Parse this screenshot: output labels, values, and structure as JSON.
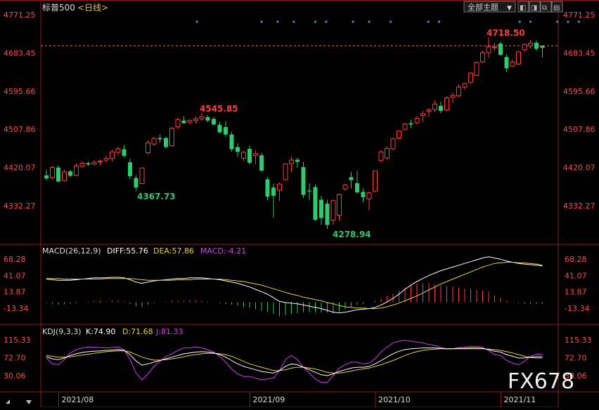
{
  "header": {
    "symbol": "标普500",
    "period": "<日线>",
    "theme_button": "全部主题",
    "theme_caret": "▼",
    "win_buttons": [
      "◧",
      "◨",
      "⧉",
      "▤"
    ]
  },
  "colors": {
    "up": "#ff3c3c",
    "down": "#32c86e",
    "axis_label": "#ff4a4a",
    "dif": "#ffffff",
    "dea": "#e6d23a",
    "macd_hist_label": "#c84bd6",
    "kdj_k": "#ffffff",
    "kdj_d": "#e6d23a",
    "kdj_j": "#d23cf0",
    "marker": "#3a8fd8",
    "frame": "#8a1a1a"
  },
  "price_panel": {
    "y_ticks": [
      "4771.25",
      "4683.45",
      "4595.66",
      "4507.86",
      "4420.07",
      "4332.27"
    ],
    "ref_line": 4700,
    "annotations": {
      "max_label": "4718.50",
      "min_label": "4278.94",
      "local_high_label": "4545.85",
      "local_low_label": "4367.73"
    },
    "markers_label": ""
  },
  "macd_panel": {
    "title": "MACD(26,12,9)",
    "dif_label": "DIFF:55.76",
    "dea_label": "DEA:57.86",
    "macd_label": "MACD:-4.21",
    "y_ticks": [
      "68.28",
      "41.07",
      "13.87",
      "-13.34"
    ]
  },
  "kdj_panel": {
    "title": "KDJ(9,3,3)",
    "k_label": "K:74.90",
    "d_label": "D:71.68",
    "j_label": "J:81.33",
    "y_ticks": [
      "115.33",
      "72.70",
      "30.06"
    ]
  },
  "x_axis": {
    "labels": [
      "2021/08",
      "2021/09",
      "2021/10",
      "2021/11"
    ]
  },
  "watermark": "FX678",
  "chart_data": {
    "type": "candlestick",
    "series_name": "标普500",
    "period": "日线",
    "ylim": [
      4250,
      4790
    ],
    "candles": [
      {
        "o": 4402,
        "h": 4415,
        "l": 4390,
        "c": 4395
      },
      {
        "o": 4397,
        "h": 4423,
        "l": 4393,
        "c": 4420
      },
      {
        "o": 4420,
        "h": 4425,
        "l": 4385,
        "c": 4388
      },
      {
        "o": 4390,
        "h": 4416,
        "l": 4388,
        "c": 4410
      },
      {
        "o": 4411,
        "h": 4415,
        "l": 4398,
        "c": 4401
      },
      {
        "o": 4402,
        "h": 4430,
        "l": 4400,
        "c": 4423
      },
      {
        "o": 4423,
        "h": 4433,
        "l": 4420,
        "c": 4430
      },
      {
        "o": 4430,
        "h": 4434,
        "l": 4424,
        "c": 4427
      },
      {
        "o": 4428,
        "h": 4437,
        "l": 4425,
        "c": 4432
      },
      {
        "o": 4433,
        "h": 4438,
        "l": 4426,
        "c": 4435
      },
      {
        "o": 4437,
        "h": 4447,
        "l": 4432,
        "c": 4441
      },
      {
        "o": 4441,
        "h": 4461,
        "l": 4434,
        "c": 4456
      },
      {
        "o": 4455,
        "h": 4468,
        "l": 4449,
        "c": 4463
      },
      {
        "o": 4462,
        "h": 4472,
        "l": 4443,
        "c": 4447
      },
      {
        "o": 4432,
        "h": 4440,
        "l": 4393,
        "c": 4400
      },
      {
        "o": 4396,
        "h": 4402,
        "l": 4367,
        "c": 4374
      },
      {
        "o": 4383,
        "h": 4420,
        "l": 4382,
        "c": 4419
      },
      {
        "o": 4454,
        "h": 4482,
        "l": 4450,
        "c": 4477
      },
      {
        "o": 4474,
        "h": 4490,
        "l": 4470,
        "c": 4487
      },
      {
        "o": 4488,
        "h": 4496,
        "l": 4477,
        "c": 4485
      },
      {
        "o": 4488,
        "h": 4490,
        "l": 4464,
        "c": 4467
      },
      {
        "o": 4470,
        "h": 4513,
        "l": 4468,
        "c": 4510
      },
      {
        "o": 4514,
        "h": 4535,
        "l": 4508,
        "c": 4530
      },
      {
        "o": 4528,
        "h": 4538,
        "l": 4520,
        "c": 4522
      },
      {
        "o": 4524,
        "h": 4532,
        "l": 4519,
        "c": 4528
      },
      {
        "o": 4528,
        "h": 4537,
        "l": 4521,
        "c": 4532
      },
      {
        "o": 4532,
        "h": 4546,
        "l": 4527,
        "c": 4537
      },
      {
        "o": 4536,
        "h": 4541,
        "l": 4524,
        "c": 4528
      },
      {
        "o": 4532,
        "h": 4536,
        "l": 4517,
        "c": 4519
      },
      {
        "o": 4518,
        "h": 4525,
        "l": 4498,
        "c": 4501
      },
      {
        "o": 4513,
        "h": 4527,
        "l": 4490,
        "c": 4496
      },
      {
        "o": 4496,
        "h": 4502,
        "l": 4456,
        "c": 4462
      },
      {
        "o": 4467,
        "h": 4476,
        "l": 4445,
        "c": 4456
      },
      {
        "o": 4441,
        "h": 4458,
        "l": 4436,
        "c": 4455
      },
      {
        "o": 4463,
        "h": 4470,
        "l": 4427,
        "c": 4431
      },
      {
        "o": 4448,
        "h": 4460,
        "l": 4428,
        "c": 4452
      },
      {
        "o": 4448,
        "h": 4454,
        "l": 4410,
        "c": 4413
      },
      {
        "o": 4393,
        "h": 4398,
        "l": 4345,
        "c": 4353
      },
      {
        "o": 4374,
        "h": 4383,
        "l": 4305,
        "c": 4355
      },
      {
        "o": 4368,
        "h": 4386,
        "l": 4343,
        "c": 4382
      },
      {
        "o": 4392,
        "h": 4430,
        "l": 4390,
        "c": 4428
      },
      {
        "o": 4429,
        "h": 4445,
        "l": 4410,
        "c": 4437
      },
      {
        "o": 4438,
        "h": 4443,
        "l": 4419,
        "c": 4433
      },
      {
        "o": 4421,
        "h": 4433,
        "l": 4350,
        "c": 4357
      },
      {
        "o": 4367,
        "h": 4384,
        "l": 4345,
        "c": 4365
      },
      {
        "o": 4375,
        "h": 4381,
        "l": 4298,
        "c": 4300
      },
      {
        "o": 4346,
        "h": 4355,
        "l": 4288,
        "c": 4304
      },
      {
        "o": 4337,
        "h": 4346,
        "l": 4279,
        "c": 4288
      },
      {
        "o": 4299,
        "h": 4347,
        "l": 4288,
        "c": 4344
      },
      {
        "o": 4310,
        "h": 4360,
        "l": 4298,
        "c": 4358
      },
      {
        "o": 4371,
        "h": 4383,
        "l": 4366,
        "c": 4380
      },
      {
        "o": 4398,
        "h": 4410,
        "l": 4372,
        "c": 4391
      },
      {
        "o": 4384,
        "h": 4412,
        "l": 4360,
        "c": 4363
      },
      {
        "o": 4364,
        "h": 4372,
        "l": 4340,
        "c": 4352
      },
      {
        "o": 4348,
        "h": 4365,
        "l": 4322,
        "c": 4362
      },
      {
        "o": 4366,
        "h": 4413,
        "l": 4364,
        "c": 4412
      },
      {
        "o": 4436,
        "h": 4460,
        "l": 4432,
        "c": 4456
      },
      {
        "o": 4442,
        "h": 4468,
        "l": 4438,
        "c": 4464
      },
      {
        "o": 4463,
        "h": 4488,
        "l": 4460,
        "c": 4486
      },
      {
        "o": 4488,
        "h": 4505,
        "l": 4485,
        "c": 4504
      },
      {
        "o": 4508,
        "h": 4523,
        "l": 4505,
        "c": 4520
      },
      {
        "o": 4522,
        "h": 4530,
        "l": 4511,
        "c": 4519
      },
      {
        "o": 4523,
        "h": 4538,
        "l": 4519,
        "c": 4533
      },
      {
        "o": 4540,
        "h": 4550,
        "l": 4525,
        "c": 4544
      },
      {
        "o": 4549,
        "h": 4556,
        "l": 4536,
        "c": 4553
      },
      {
        "o": 4554,
        "h": 4574,
        "l": 4548,
        "c": 4566
      },
      {
        "o": 4562,
        "h": 4572,
        "l": 4545,
        "c": 4550
      },
      {
        "o": 4552,
        "h": 4584,
        "l": 4550,
        "c": 4580
      },
      {
        "o": 4582,
        "h": 4592,
        "l": 4568,
        "c": 4586
      },
      {
        "o": 4585,
        "h": 4611,
        "l": 4582,
        "c": 4605
      },
      {
        "o": 4605,
        "h": 4615,
        "l": 4599,
        "c": 4613
      },
      {
        "o": 4616,
        "h": 4640,
        "l": 4612,
        "c": 4637
      },
      {
        "o": 4632,
        "h": 4664,
        "l": 4630,
        "c": 4661
      },
      {
        "o": 4663,
        "h": 4689,
        "l": 4660,
        "c": 4684
      },
      {
        "o": 4684,
        "h": 4719,
        "l": 4672,
        "c": 4698
      },
      {
        "o": 4697,
        "h": 4706,
        "l": 4688,
        "c": 4697
      },
      {
        "o": 4705,
        "h": 4710,
        "l": 4677,
        "c": 4679
      },
      {
        "o": 4674,
        "h": 4680,
        "l": 4640,
        "c": 4648
      },
      {
        "o": 4653,
        "h": 4668,
        "l": 4652,
        "c": 4663
      },
      {
        "o": 4658,
        "h": 4688,
        "l": 4655,
        "c": 4686
      },
      {
        "o": 4691,
        "h": 4705,
        "l": 4686,
        "c": 4703
      },
      {
        "o": 4700,
        "h": 4713,
        "l": 4694,
        "c": 4706
      },
      {
        "o": 4707,
        "h": 4712,
        "l": 4688,
        "c": 4693
      },
      {
        "o": 4700,
        "h": 4702,
        "l": 4673,
        "c": 4695
      }
    ],
    "macd": {
      "dif": [
        35,
        34,
        33,
        33,
        33,
        34,
        35,
        36,
        37,
        37,
        37,
        38,
        38,
        37,
        34,
        30,
        28,
        30,
        32,
        33,
        34,
        35,
        36,
        36,
        37,
        37,
        37,
        36,
        35,
        34,
        32,
        30,
        28,
        25,
        22,
        18,
        14,
        10,
        4,
        -2,
        -4,
        -5,
        -6,
        -8,
        -10,
        -12,
        -14,
        -17,
        -20,
        -21,
        -20,
        -18,
        -16,
        -15,
        -14,
        -12,
        -8,
        -3,
        3,
        10,
        18,
        25,
        31,
        36,
        41,
        45,
        49,
        52,
        55,
        58,
        61,
        64,
        67,
        70,
        72,
        70,
        68,
        65,
        63,
        61,
        60,
        59,
        58,
        57
      ],
      "dea": [
        36,
        36,
        36,
        35,
        35,
        35,
        35,
        35,
        35,
        35,
        36,
        36,
        36,
        36,
        36,
        35,
        34,
        33,
        33,
        33,
        33,
        33,
        34,
        34,
        34,
        35,
        35,
        35,
        35,
        35,
        34,
        33,
        32,
        31,
        29,
        27,
        25,
        22,
        19,
        16,
        13,
        10,
        8,
        5,
        3,
        1,
        -1,
        -4,
        -6,
        -9,
        -11,
        -12,
        -13,
        -13,
        -14,
        -14,
        -13,
        -11,
        -8,
        -5,
        -1,
        3,
        7,
        12,
        17,
        22,
        27,
        31,
        35,
        39,
        43,
        47,
        51,
        55,
        58,
        61,
        62,
        63,
        63,
        62,
        62,
        61,
        60,
        58
      ],
      "hist": [
        -2,
        -4,
        -6,
        -5,
        -4,
        -2,
        0,
        2,
        4,
        4,
        2,
        4,
        4,
        2,
        -4,
        -10,
        -12,
        -6,
        -2,
        0,
        2,
        4,
        4,
        4,
        6,
        4,
        4,
        2,
        0,
        -2,
        -4,
        -6,
        -8,
        -12,
        -14,
        -18,
        -22,
        -24,
        -30,
        -36,
        -34,
        -30,
        -28,
        -26,
        -26,
        -26,
        -26,
        -26,
        -28,
        -24,
        -18,
        -12,
        -6,
        -4,
        0,
        4,
        10,
        16,
        22,
        30,
        38,
        44,
        48,
        48,
        50,
        46,
        44,
        42,
        40,
        38,
        36,
        34,
        32,
        30,
        28,
        18,
        12,
        4,
        0,
        -2,
        -4,
        -4,
        -4,
        -4
      ]
    },
    "kdj": {
      "k": [
        75,
        70,
        68,
        72,
        78,
        82,
        85,
        87,
        88,
        89,
        90,
        91,
        92,
        90,
        80,
        65,
        55,
        58,
        62,
        66,
        70,
        74,
        78,
        82,
        84,
        86,
        87,
        86,
        84,
        80,
        74,
        66,
        58,
        52,
        48,
        44,
        40,
        38,
        36,
        42,
        52,
        58,
        56,
        50,
        44,
        38,
        32,
        30,
        34,
        40,
        44,
        48,
        50,
        50,
        52,
        58,
        66,
        74,
        82,
        88,
        92,
        94,
        95,
        96,
        96,
        96,
        95,
        94,
        94,
        95,
        95,
        96,
        96,
        95,
        92,
        88,
        86,
        80,
        76,
        72,
        72,
        74,
        75,
        75
      ],
      "d": [
        78,
        76,
        74,
        74,
        75,
        77,
        79,
        81,
        83,
        85,
        87,
        88,
        89,
        89,
        86,
        80,
        74,
        70,
        67,
        67,
        68,
        70,
        72,
        75,
        78,
        80,
        82,
        83,
        83,
        82,
        80,
        76,
        70,
        64,
        58,
        54,
        50,
        46,
        42,
        42,
        44,
        48,
        50,
        50,
        48,
        46,
        42,
        38,
        36,
        36,
        38,
        41,
        44,
        46,
        48,
        52,
        56,
        61,
        66,
        72,
        78,
        83,
        87,
        90,
        92,
        93,
        94,
        94,
        94,
        94,
        94,
        94,
        94,
        94,
        93,
        92,
        90,
        87,
        84,
        80,
        76,
        73,
        72,
        72
      ],
      "j": [
        72,
        58,
        56,
        68,
        84,
        92,
        96,
        98,
        98,
        97,
        96,
        97,
        98,
        92,
        68,
        36,
        20,
        34,
        52,
        64,
        76,
        82,
        90,
        96,
        96,
        98,
        96,
        92,
        86,
        76,
        62,
        46,
        34,
        28,
        28,
        24,
        20,
        22,
        24,
        42,
        68,
        78,
        68,
        50,
        36,
        22,
        14,
        14,
        30,
        48,
        56,
        62,
        62,
        58,
        60,
        70,
        86,
        98,
        108,
        112,
        114,
        112,
        110,
        108,
        104,
        102,
        97,
        94,
        94,
        97,
        97,
        100,
        100,
        97,
        90,
        80,
        78,
        66,
        60,
        56,
        64,
        76,
        81,
        81
      ]
    },
    "x_axis_labels": [
      "2021/08",
      "2021/09",
      "2021/10",
      "2021/11"
    ],
    "x_label_indices": [
      3,
      35,
      56,
      77
    ],
    "marker_indices": [
      28,
      40,
      43,
      46,
      50,
      52,
      57,
      60,
      64,
      71,
      73,
      88,
      90,
      95,
      97,
      99
    ],
    "legend": "top-left"
  }
}
